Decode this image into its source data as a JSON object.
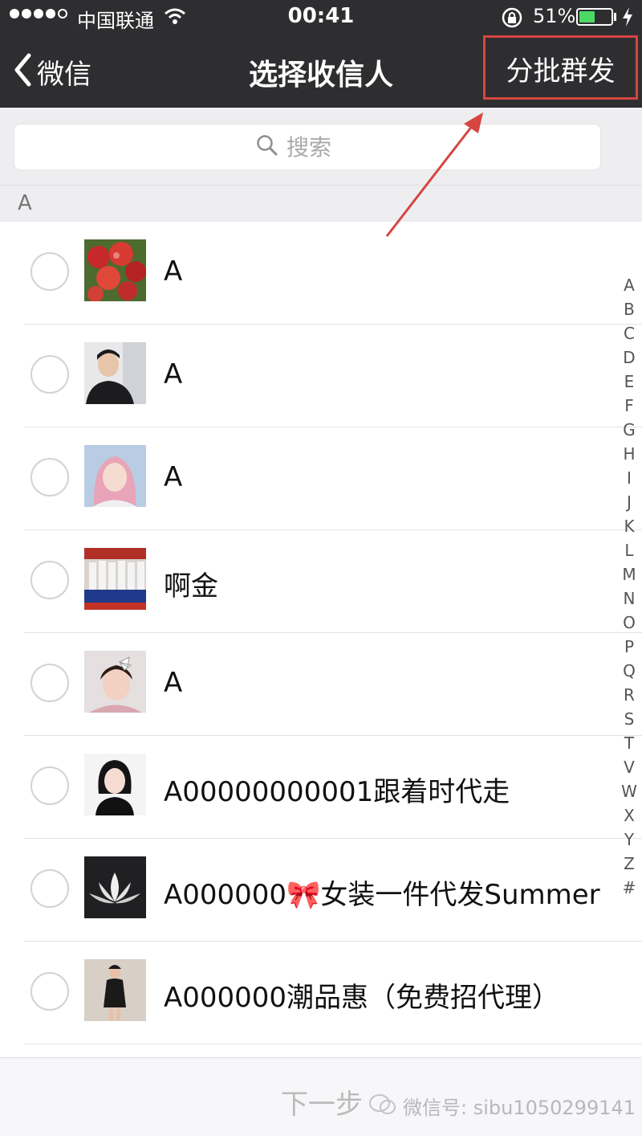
{
  "status_bar": {
    "carrier": "中国联通",
    "time": "00:41",
    "battery_percent": "51%",
    "battery_level": 0.51,
    "icons": [
      "signal-dots",
      "wifi-icon",
      "rotation-lock-icon",
      "battery-icon",
      "charging-bolt-icon"
    ]
  },
  "nav": {
    "back_label": "微信",
    "title": "选择收信人",
    "batch_label": "分批群发",
    "highlight_color": "#d64541"
  },
  "search": {
    "placeholder": "搜索"
  },
  "section": {
    "letter": "A"
  },
  "contacts": [
    {
      "name": "A",
      "avatar": "apples-photo"
    },
    {
      "name": "A",
      "avatar": "man-portrait"
    },
    {
      "name": "A",
      "avatar": "girl-pink-hair"
    },
    {
      "name": "啊金",
      "avatar": "group-photo"
    },
    {
      "name": "A",
      "avatar": "girl-with-bow"
    },
    {
      "name": "A00000000001跟着时代走",
      "avatar": "girl-black-dress"
    },
    {
      "name": "A000000🎀女装一件代发Summer",
      "avatar": "white-lotus"
    },
    {
      "name": "A000000潮品惠（免费招代理）",
      "avatar": "fashion-model"
    }
  ],
  "index_letters": [
    "A",
    "B",
    "C",
    "D",
    "E",
    "F",
    "G",
    "H",
    "I",
    "J",
    "K",
    "L",
    "M",
    "N",
    "O",
    "P",
    "Q",
    "R",
    "S",
    "T",
    "V",
    "W",
    "X",
    "Y",
    "Z",
    "#"
  ],
  "bottom": {
    "next_label": "下一步",
    "watermark": "微信号: sibu1050299141"
  },
  "colors": {
    "nav_background": "#2e2e31",
    "battery_green": "#4cd964",
    "annotation_red": "#d64541"
  }
}
